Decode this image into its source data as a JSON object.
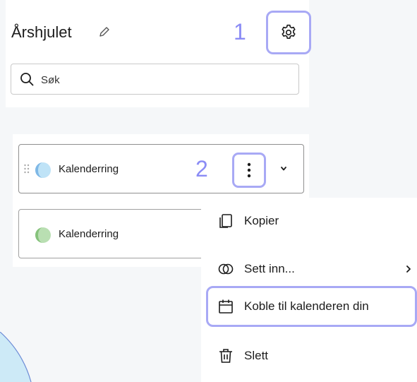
{
  "header": {
    "title": "Årshjulet",
    "step_marker_1": "1"
  },
  "search": {
    "placeholder": "Søk"
  },
  "rings": {
    "step_marker_2": "2",
    "items": [
      {
        "label": "Kalenderring",
        "color": "#bfe3f7"
      },
      {
        "label": "Kalenderring",
        "color": "#b9dfb2"
      }
    ]
  },
  "menu": {
    "items": [
      {
        "label": "Kopier",
        "icon": "copy-icon"
      },
      {
        "label": "Sett inn...",
        "icon": "overlap-circles-icon"
      },
      {
        "label": "Koble til kalenderen din",
        "icon": "calendar-icon"
      },
      {
        "label": "Slett",
        "icon": "trash-icon"
      }
    ]
  },
  "colors": {
    "highlight": "#a8a9f5",
    "step_number": "#8b8cf5",
    "background": "#f5f7f9"
  }
}
